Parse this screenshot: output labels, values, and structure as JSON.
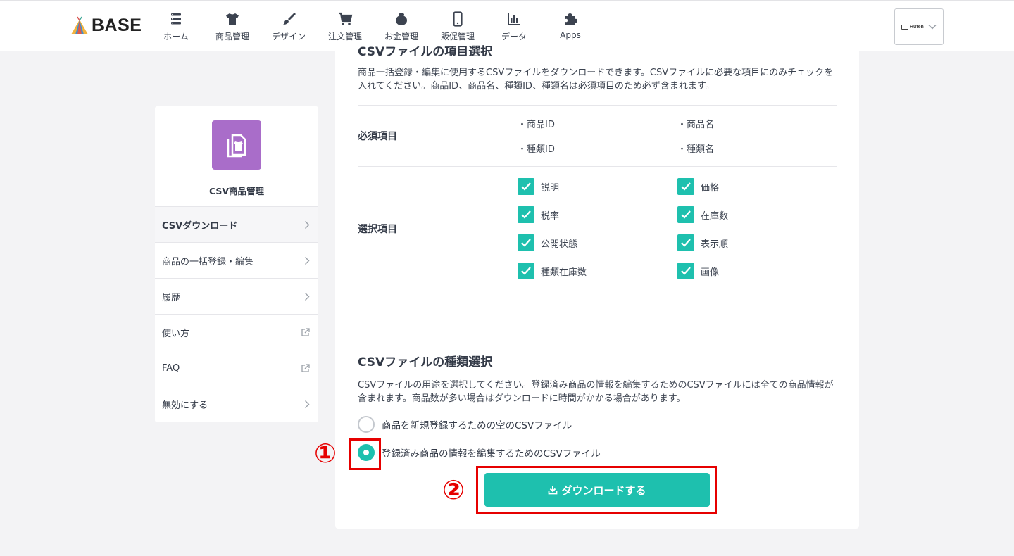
{
  "header": {
    "logo_text": "BASE",
    "nav": [
      {
        "icon": "home-icon",
        "label": "ホーム"
      },
      {
        "icon": "tshirt-icon",
        "label": "商品管理"
      },
      {
        "icon": "brush-icon",
        "label": "デザイン"
      },
      {
        "icon": "cart-icon",
        "label": "注文管理"
      },
      {
        "icon": "wallet-icon",
        "label": "お金管理"
      },
      {
        "icon": "phone-icon",
        "label": "販促管理"
      },
      {
        "icon": "bar-chart-icon",
        "label": "データ"
      },
      {
        "icon": "puzzle-icon",
        "label": "Apps"
      }
    ],
    "shop_label": "Ruten"
  },
  "sidebar": {
    "title": "CSV商品管理",
    "items": [
      {
        "label": "CSVダウンロード",
        "icon": "chevron-right-icon",
        "active": true
      },
      {
        "label": "商品の一括登録・編集",
        "icon": "chevron-right-icon"
      },
      {
        "label": "履歴",
        "icon": "chevron-right-icon"
      },
      {
        "label": "使い方",
        "icon": "external-link-icon"
      },
      {
        "label": "FAQ",
        "icon": "external-link-icon"
      },
      {
        "label": "無効にする",
        "icon": "chevron-right-icon"
      }
    ]
  },
  "main": {
    "section1": {
      "title": "CSVファイルの項目選択",
      "description": "商品一括登録・編集に使用するCSVファイルをダウンロードできます。CSVファイルに必要な項目にのみチェックを入れてください。商品ID、商品名、種類ID、種類名は必須項目のため必ず含まれます。",
      "required_label": "必須項目",
      "required_items": [
        "・商品ID",
        "・商品名",
        "・種類ID",
        "・種類名"
      ],
      "optional_label": "選択項目",
      "optional_items": [
        {
          "label": "説明",
          "checked": true
        },
        {
          "label": "価格",
          "checked": true
        },
        {
          "label": "税率",
          "checked": true
        },
        {
          "label": "在庫数",
          "checked": true
        },
        {
          "label": "公開状態",
          "checked": true
        },
        {
          "label": "表示順",
          "checked": true
        },
        {
          "label": "種類在庫数",
          "checked": true
        },
        {
          "label": "画像",
          "checked": true
        }
      ]
    },
    "section2": {
      "title": "CSVファイルの種類選択",
      "description": "CSVファイルの用途を選択してください。登録済み商品の情報を編集するためのCSVファイルには全ての商品情報が含まれます。商品数が多い場合はダウンロードに時間がかかる場合があります。",
      "options": [
        {
          "label": "商品を新規登録するための空のCSVファイル",
          "selected": false
        },
        {
          "label": "登録済み商品の情報を編集するためのCSVファイル",
          "selected": true
        }
      ],
      "download_button": "ダウンロードする"
    }
  },
  "annotations": {
    "marker1": "①",
    "marker2": "②",
    "color": "#e60000"
  },
  "colors": {
    "accent": "#1ec0ae",
    "app_icon": "#a96dc9"
  }
}
